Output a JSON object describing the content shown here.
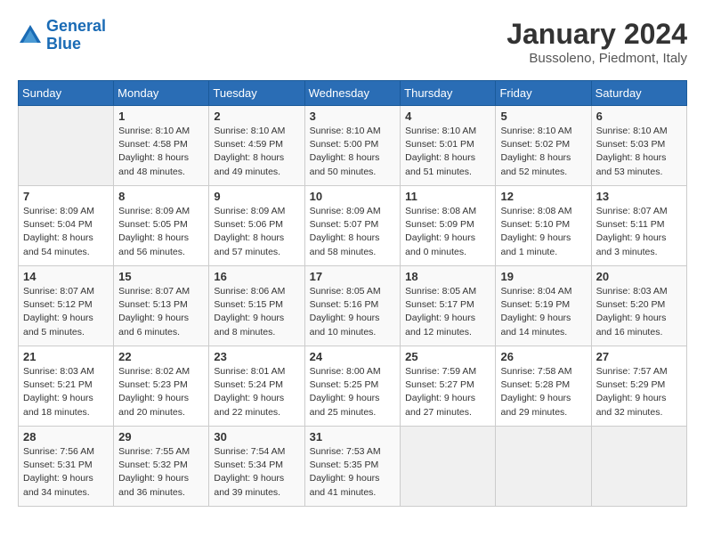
{
  "header": {
    "logo_general": "General",
    "logo_blue": "Blue",
    "month_title": "January 2024",
    "subtitle": "Bussoleno, Piedmont, Italy"
  },
  "weekdays": [
    "Sunday",
    "Monday",
    "Tuesday",
    "Wednesday",
    "Thursday",
    "Friday",
    "Saturday"
  ],
  "weeks": [
    [
      {
        "day": "",
        "sunrise": "",
        "sunset": "",
        "daylight": ""
      },
      {
        "day": "1",
        "sunrise": "Sunrise: 8:10 AM",
        "sunset": "Sunset: 4:58 PM",
        "daylight": "Daylight: 8 hours and 48 minutes."
      },
      {
        "day": "2",
        "sunrise": "Sunrise: 8:10 AM",
        "sunset": "Sunset: 4:59 PM",
        "daylight": "Daylight: 8 hours and 49 minutes."
      },
      {
        "day": "3",
        "sunrise": "Sunrise: 8:10 AM",
        "sunset": "Sunset: 5:00 PM",
        "daylight": "Daylight: 8 hours and 50 minutes."
      },
      {
        "day": "4",
        "sunrise": "Sunrise: 8:10 AM",
        "sunset": "Sunset: 5:01 PM",
        "daylight": "Daylight: 8 hours and 51 minutes."
      },
      {
        "day": "5",
        "sunrise": "Sunrise: 8:10 AM",
        "sunset": "Sunset: 5:02 PM",
        "daylight": "Daylight: 8 hours and 52 minutes."
      },
      {
        "day": "6",
        "sunrise": "Sunrise: 8:10 AM",
        "sunset": "Sunset: 5:03 PM",
        "daylight": "Daylight: 8 hours and 53 minutes."
      }
    ],
    [
      {
        "day": "7",
        "sunrise": "Sunrise: 8:09 AM",
        "sunset": "Sunset: 5:04 PM",
        "daylight": "Daylight: 8 hours and 54 minutes."
      },
      {
        "day": "8",
        "sunrise": "Sunrise: 8:09 AM",
        "sunset": "Sunset: 5:05 PM",
        "daylight": "Daylight: 8 hours and 56 minutes."
      },
      {
        "day": "9",
        "sunrise": "Sunrise: 8:09 AM",
        "sunset": "Sunset: 5:06 PM",
        "daylight": "Daylight: 8 hours and 57 minutes."
      },
      {
        "day": "10",
        "sunrise": "Sunrise: 8:09 AM",
        "sunset": "Sunset: 5:07 PM",
        "daylight": "Daylight: 8 hours and 58 minutes."
      },
      {
        "day": "11",
        "sunrise": "Sunrise: 8:08 AM",
        "sunset": "Sunset: 5:09 PM",
        "daylight": "Daylight: 9 hours and 0 minutes."
      },
      {
        "day": "12",
        "sunrise": "Sunrise: 8:08 AM",
        "sunset": "Sunset: 5:10 PM",
        "daylight": "Daylight: 9 hours and 1 minute."
      },
      {
        "day": "13",
        "sunrise": "Sunrise: 8:07 AM",
        "sunset": "Sunset: 5:11 PM",
        "daylight": "Daylight: 9 hours and 3 minutes."
      }
    ],
    [
      {
        "day": "14",
        "sunrise": "Sunrise: 8:07 AM",
        "sunset": "Sunset: 5:12 PM",
        "daylight": "Daylight: 9 hours and 5 minutes."
      },
      {
        "day": "15",
        "sunrise": "Sunrise: 8:07 AM",
        "sunset": "Sunset: 5:13 PM",
        "daylight": "Daylight: 9 hours and 6 minutes."
      },
      {
        "day": "16",
        "sunrise": "Sunrise: 8:06 AM",
        "sunset": "Sunset: 5:15 PM",
        "daylight": "Daylight: 9 hours and 8 minutes."
      },
      {
        "day": "17",
        "sunrise": "Sunrise: 8:05 AM",
        "sunset": "Sunset: 5:16 PM",
        "daylight": "Daylight: 9 hours and 10 minutes."
      },
      {
        "day": "18",
        "sunrise": "Sunrise: 8:05 AM",
        "sunset": "Sunset: 5:17 PM",
        "daylight": "Daylight: 9 hours and 12 minutes."
      },
      {
        "day": "19",
        "sunrise": "Sunrise: 8:04 AM",
        "sunset": "Sunset: 5:19 PM",
        "daylight": "Daylight: 9 hours and 14 minutes."
      },
      {
        "day": "20",
        "sunrise": "Sunrise: 8:03 AM",
        "sunset": "Sunset: 5:20 PM",
        "daylight": "Daylight: 9 hours and 16 minutes."
      }
    ],
    [
      {
        "day": "21",
        "sunrise": "Sunrise: 8:03 AM",
        "sunset": "Sunset: 5:21 PM",
        "daylight": "Daylight: 9 hours and 18 minutes."
      },
      {
        "day": "22",
        "sunrise": "Sunrise: 8:02 AM",
        "sunset": "Sunset: 5:23 PM",
        "daylight": "Daylight: 9 hours and 20 minutes."
      },
      {
        "day": "23",
        "sunrise": "Sunrise: 8:01 AM",
        "sunset": "Sunset: 5:24 PM",
        "daylight": "Daylight: 9 hours and 22 minutes."
      },
      {
        "day": "24",
        "sunrise": "Sunrise: 8:00 AM",
        "sunset": "Sunset: 5:25 PM",
        "daylight": "Daylight: 9 hours and 25 minutes."
      },
      {
        "day": "25",
        "sunrise": "Sunrise: 7:59 AM",
        "sunset": "Sunset: 5:27 PM",
        "daylight": "Daylight: 9 hours and 27 minutes."
      },
      {
        "day": "26",
        "sunrise": "Sunrise: 7:58 AM",
        "sunset": "Sunset: 5:28 PM",
        "daylight": "Daylight: 9 hours and 29 minutes."
      },
      {
        "day": "27",
        "sunrise": "Sunrise: 7:57 AM",
        "sunset": "Sunset: 5:29 PM",
        "daylight": "Daylight: 9 hours and 32 minutes."
      }
    ],
    [
      {
        "day": "28",
        "sunrise": "Sunrise: 7:56 AM",
        "sunset": "Sunset: 5:31 PM",
        "daylight": "Daylight: 9 hours and 34 minutes."
      },
      {
        "day": "29",
        "sunrise": "Sunrise: 7:55 AM",
        "sunset": "Sunset: 5:32 PM",
        "daylight": "Daylight: 9 hours and 36 minutes."
      },
      {
        "day": "30",
        "sunrise": "Sunrise: 7:54 AM",
        "sunset": "Sunset: 5:34 PM",
        "daylight": "Daylight: 9 hours and 39 minutes."
      },
      {
        "day": "31",
        "sunrise": "Sunrise: 7:53 AM",
        "sunset": "Sunset: 5:35 PM",
        "daylight": "Daylight: 9 hours and 41 minutes."
      },
      {
        "day": "",
        "sunrise": "",
        "sunset": "",
        "daylight": ""
      },
      {
        "day": "",
        "sunrise": "",
        "sunset": "",
        "daylight": ""
      },
      {
        "day": "",
        "sunrise": "",
        "sunset": "",
        "daylight": ""
      }
    ]
  ]
}
